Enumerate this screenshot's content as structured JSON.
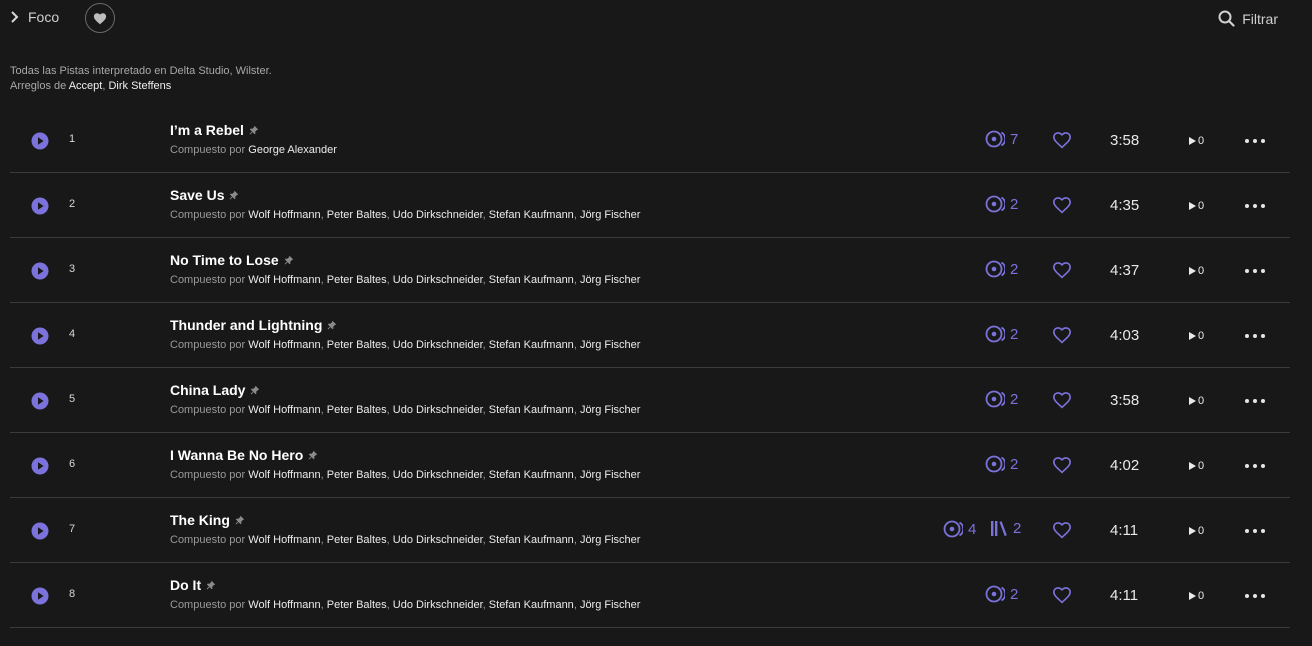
{
  "header": {
    "breadcrumb_label": "Foco",
    "filter_label": "Filtrar"
  },
  "credits": {
    "line1": "Todas las Pistas interpretado en Delta Studio, Wilster.",
    "arranged_prefix": "Arreglos de ",
    "arrangers": [
      "Accept",
      "Dirk Steffens"
    ],
    "separator": ", "
  },
  "composer_prefix": "Compuesto por ",
  "colors": {
    "accent": "#7b72dc",
    "background": "#181818",
    "divider": "#3b3b3b"
  },
  "tracks": [
    {
      "number": "1",
      "title": "I’m a Rebel",
      "composers": "George Alexander",
      "versions": "7",
      "albums": null,
      "duration": "3:58",
      "plays": "0"
    },
    {
      "number": "2",
      "title": "Save Us",
      "composers": "Wolf Hoffmann, Peter Baltes, Udo Dirkschneider, Stefan Kaufmann, Jörg Fischer",
      "versions": "2",
      "albums": null,
      "duration": "4:35",
      "plays": "0"
    },
    {
      "number": "3",
      "title": "No Time to Lose",
      "composers": "Wolf Hoffmann, Peter Baltes, Udo Dirkschneider, Stefan Kaufmann, Jörg Fischer",
      "versions": "2",
      "albums": null,
      "duration": "4:37",
      "plays": "0"
    },
    {
      "number": "4",
      "title": "Thunder and Lightning",
      "composers": "Wolf Hoffmann, Peter Baltes, Udo Dirkschneider, Stefan Kaufmann, Jörg Fischer",
      "versions": "2",
      "albums": null,
      "duration": "4:03",
      "plays": "0"
    },
    {
      "number": "5",
      "title": "China Lady",
      "composers": "Wolf Hoffmann, Peter Baltes, Udo Dirkschneider, Stefan Kaufmann, Jörg Fischer",
      "versions": "2",
      "albums": null,
      "duration": "3:58",
      "plays": "0"
    },
    {
      "number": "6",
      "title": "I Wanna Be No Hero",
      "composers": "Wolf Hoffmann, Peter Baltes, Udo Dirkschneider, Stefan Kaufmann, Jörg Fischer",
      "versions": "2",
      "albums": null,
      "duration": "4:02",
      "plays": "0"
    },
    {
      "number": "7",
      "title": "The King",
      "composers": "Wolf Hoffmann, Peter Baltes, Udo Dirkschneider, Stefan Kaufmann, Jörg Fischer",
      "versions": "4",
      "albums": "2",
      "duration": "4:11",
      "plays": "0"
    },
    {
      "number": "8",
      "title": "Do It",
      "composers": "Wolf Hoffmann, Peter Baltes, Udo Dirkschneider, Stefan Kaufmann, Jörg Fischer",
      "versions": "2",
      "albums": null,
      "duration": "4:11",
      "plays": "0"
    }
  ]
}
